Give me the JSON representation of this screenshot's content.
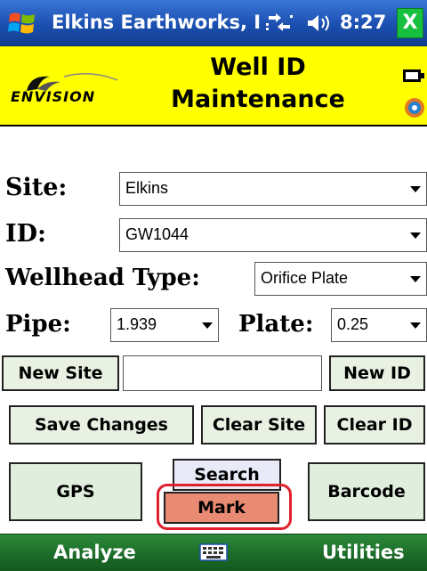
{
  "titlebar": {
    "title": "Elkins Earthworks, I",
    "time": "8:27",
    "close_label": "X"
  },
  "header": {
    "logo_text": "ENVISION",
    "title_line1": "Well ID",
    "title_line2": "Maintenance"
  },
  "form": {
    "site_label": "Site:",
    "site_value": "Elkins",
    "id_label": "ID:",
    "id_value": "GW1044",
    "wellhead_label": "Wellhead Type:",
    "wellhead_value": "Orifice Plate",
    "pipe_label": "Pipe:",
    "pipe_value": "1.939",
    "plate_label": "Plate:",
    "plate_value": "0.25",
    "new_site_text": ""
  },
  "buttons": {
    "new_site": "New Site",
    "new_id": "New ID",
    "save_changes": "Save Changes",
    "clear_site": "Clear Site",
    "clear_id": "Clear ID",
    "gps": "GPS",
    "search": "Search",
    "mark": "Mark",
    "barcode": "Barcode"
  },
  "softkeys": {
    "left": "Analyze",
    "right": "Utilities"
  },
  "colors": {
    "header_bg": "#ffff00",
    "title_bar": "#1b4fb0",
    "bottom_bar": "#1b6a28",
    "button_bg": "#e9f1e2",
    "mark_bg": "#e98a72",
    "highlight_ring": "#e0202a"
  }
}
